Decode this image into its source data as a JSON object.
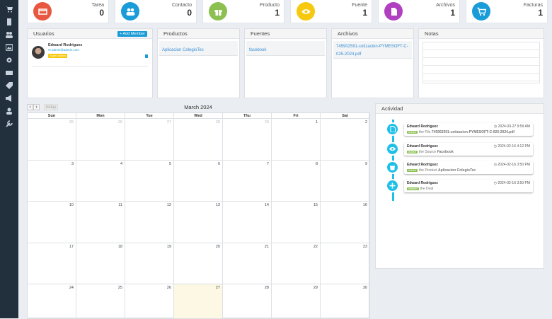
{
  "sidebar": {
    "icons": [
      "cart-icon",
      "book-icon",
      "users-icon",
      "image-icon",
      "gear-icon",
      "mail-icon",
      "tag-icon",
      "bullhorn-icon",
      "user-icon",
      "wrench-icon"
    ]
  },
  "stats": [
    {
      "label": "Tarea",
      "value": "0",
      "color": "#e8573f",
      "icon": "card-icon"
    },
    {
      "label": "Contacto",
      "value": "0",
      "color": "#1a9cd8",
      "icon": "users-icon"
    },
    {
      "label": "Producto",
      "value": "1",
      "color": "#8cc152",
      "icon": "gift-icon"
    },
    {
      "label": "Fuente",
      "value": "1",
      "color": "#f6c90e",
      "icon": "eye-icon"
    },
    {
      "label": "Archivos",
      "value": "1",
      "color": "#b040c0",
      "icon": "file-icon"
    },
    {
      "label": "Facturas",
      "value": "1",
      "color": "#1a9cd8",
      "icon": "cart-icon"
    }
  ],
  "panels": {
    "usuarios": {
      "title": "Usuarios",
      "add_button": "Add Member",
      "user_name": "Edward Rodriguez",
      "user_email": "admin@admin.com",
      "user_badge": "Super Admin"
    },
    "productos": {
      "title": "Productos",
      "item": "Aplicacion ColegioTec"
    },
    "fuentes": {
      "title": "Fuentes",
      "item": "facebook"
    },
    "archivos": {
      "title": "Archivos",
      "item": "745902591-cotizacion-PYMESOFT-C-025-2024.pdf"
    },
    "notas": {
      "title": "Notas"
    }
  },
  "calendar": {
    "title": "March 2024",
    "today_button": "today",
    "prev": "‹",
    "next": "›",
    "days": [
      "Sun",
      "Mon",
      "Tue",
      "Wed",
      "Thu",
      "Fri",
      "Sat"
    ],
    "weeks": [
      [
        "25",
        "26",
        "27",
        "28",
        "29",
        "1",
        "2"
      ],
      [
        "3",
        "4",
        "5",
        "6",
        "7",
        "8",
        "9"
      ],
      [
        "10",
        "11",
        "12",
        "13",
        "14",
        "15",
        "16"
      ],
      [
        "17",
        "18",
        "19",
        "20",
        "21",
        "22",
        "23"
      ],
      [
        "24",
        "25",
        "26",
        "27",
        "28",
        "29",
        "30"
      ]
    ],
    "today_cell": "27"
  },
  "activity": {
    "title": "Actividad",
    "items": [
      {
        "user": "Edward Rodriguez",
        "time": "2024-03-27 9:59 AM",
        "badge": "Added",
        "text": "the File",
        "bold": "745902591-cotizacion-PYMESOFT-C-025-2024.pdf",
        "icon": "pdf-icon"
      },
      {
        "user": "Edward Rodriguez",
        "time": "2024-02-16 4:12 PM",
        "badge": "Added",
        "text": "the Source",
        "bold": "Facebook",
        "icon": "eye-icon"
      },
      {
        "user": "Edward Rodriguez",
        "time": "2024-02-16 3:50 PM",
        "badge": "Added",
        "text": "the Product",
        "bold": "Aplicacion ColegioTec",
        "icon": "gift-icon"
      },
      {
        "user": "Edward Rodriguez",
        "time": "2024-02-16 3:50 PM",
        "badge": "created",
        "text": "the Deal",
        "bold": "",
        "icon": "plus-icon"
      }
    ]
  }
}
